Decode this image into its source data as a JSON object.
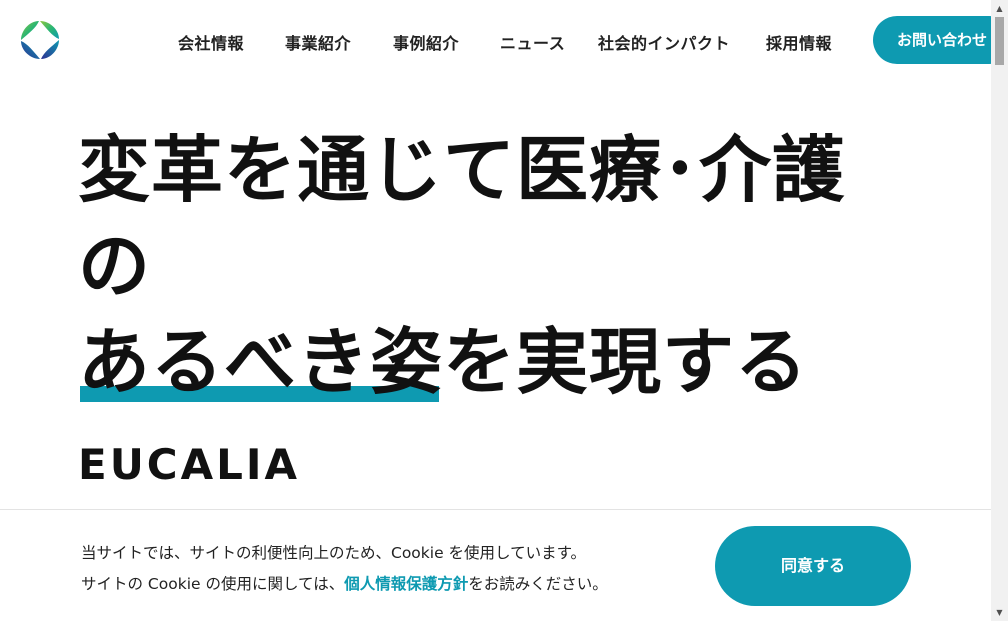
{
  "header": {
    "logo_colors": [
      "#2bb673",
      "#8dc63f",
      "#0e9ab1",
      "#2e3192"
    ],
    "nav": [
      {
        "label": "会社情報"
      },
      {
        "label": "事業紹介"
      },
      {
        "label": "事例紹介"
      },
      {
        "label": "ニュース"
      },
      {
        "label": "社会的インパクト"
      },
      {
        "label": "採用情報"
      }
    ],
    "contact_label": "お問い合わせ"
  },
  "hero": {
    "line1": "変革を通じて医療･介護",
    "line2": "の",
    "line3_highlight": "あるべき姿",
    "line3_rest": "を実現する",
    "brand": "EUCALIA"
  },
  "cookie": {
    "line1": "当サイトでは、サイトの利便性向上のため、Cookie を使用しています。",
    "line2_pre": "サイトの Cookie の使用に関しては、",
    "line2_link": "個人情報保護方針",
    "line2_post": "をお読みください。",
    "agree_label": "同意する"
  },
  "scrollbar": {
    "up": "▲",
    "down": "▼"
  },
  "colors": {
    "accent": "#0e9ab1",
    "text": "#111111"
  }
}
